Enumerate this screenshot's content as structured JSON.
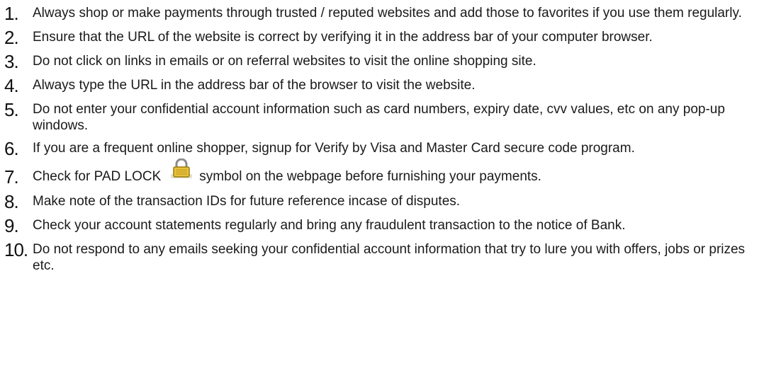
{
  "tips": [
    {
      "number": "1.",
      "text": "Always shop or make payments through trusted / reputed websites and add those to favorites if you use them regularly."
    },
    {
      "number": "2.",
      "text": "Ensure that the URL of the website is correct by verifying it in the address bar of your computer browser."
    },
    {
      "number": "3.",
      "text": "Do not click on links in emails or on referral websites to visit the online shopping site."
    },
    {
      "number": "4.",
      "text": "Always type the URL in the address bar of the browser to visit the website."
    },
    {
      "number": "5.",
      "text": "Do not enter your confidential account information such as card numbers, expiry date, cvv values, etc on any pop-up windows."
    },
    {
      "number": "6.",
      "text": "If you are a frequent online shopper, signup for Verify by Visa and Master Card secure code program."
    },
    {
      "number": "7.",
      "text_before": "Check for PAD LOCK",
      "text_after": "symbol on the webpage before furnishing your  payments.",
      "icon": "padlock-icon"
    },
    {
      "number": "8.",
      "text": "Make note of the transaction IDs for future reference incase of disputes."
    },
    {
      "number": "9.",
      "text": "Check your account statements regularly and bring any fraudulent transaction to the notice of Bank."
    },
    {
      "number": "10.",
      "text": "Do not respond to any emails seeking your confidential account information that try to lure you with offers, jobs or prizes etc."
    }
  ],
  "colors": {
    "text": "#1a1a1a",
    "padlock_body": "#e8c33a",
    "padlock_shackle": "#8a8a8a"
  }
}
